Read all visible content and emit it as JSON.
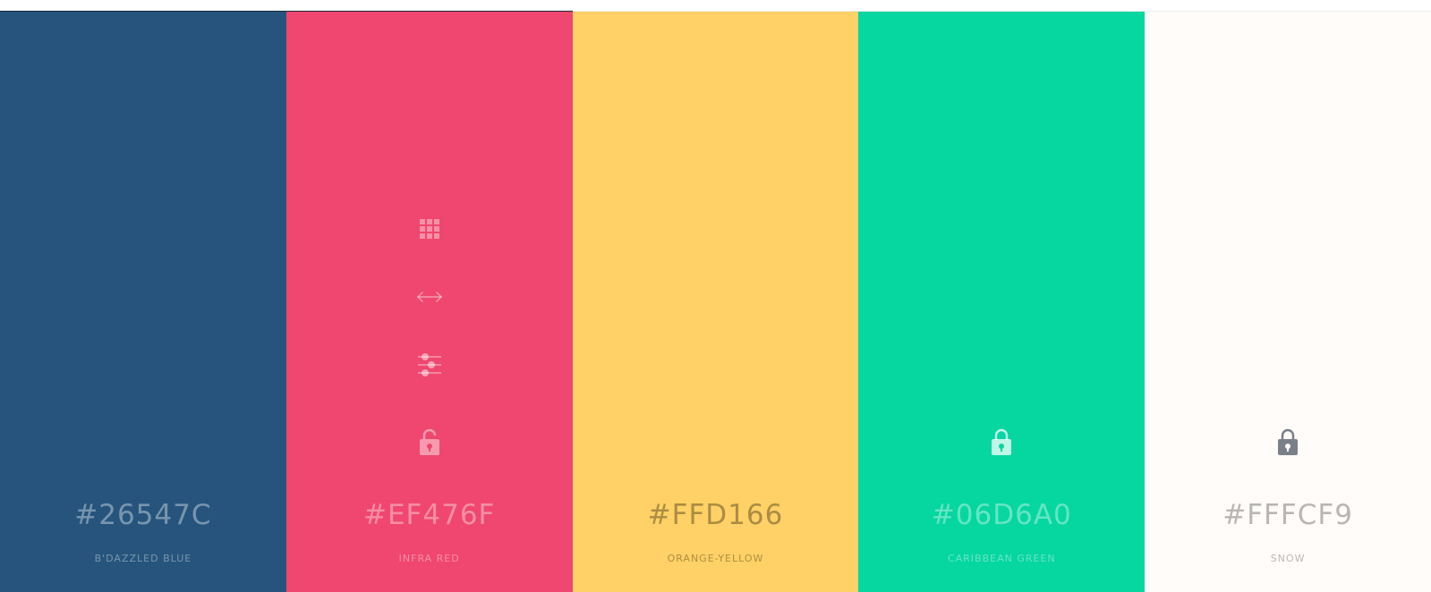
{
  "swatches": [
    {
      "hex": "#26547C",
      "name": "B'DAZZLED BLUE",
      "background": "#26547c",
      "text_color": "rgba(255,255,255,0.38)",
      "lock_color": null,
      "show_tools": false
    },
    {
      "hex": "#EF476F",
      "name": "INFRA RED",
      "background": "#ef476f",
      "text_color": "rgba(255,255,255,0.38)",
      "lock_color": "rgba(255,255,255,0.45)",
      "show_tools": true,
      "tools": [
        "grid-icon",
        "drag-arrows-icon",
        "sliders-icon"
      ]
    },
    {
      "hex": "#FFD166",
      "name": "ORANGE-YELLOW",
      "background": "#ffd166",
      "text_color": "rgba(0,0,0,0.33)",
      "lock_color": null,
      "show_tools": false
    },
    {
      "hex": "#06D6A0",
      "name": "CARIBBEAN GREEN",
      "background": "#06d6a0",
      "text_color": "rgba(255,255,255,0.38)",
      "lock_color": "rgba(255,255,255,0.75)",
      "show_tools": false
    },
    {
      "hex": "#FFFCF9",
      "name": "SNOW",
      "background": "#fffcf9",
      "text_color": "rgba(0,0,0,0.28)",
      "lock_color": "#7b7f89",
      "show_tools": false
    }
  ]
}
